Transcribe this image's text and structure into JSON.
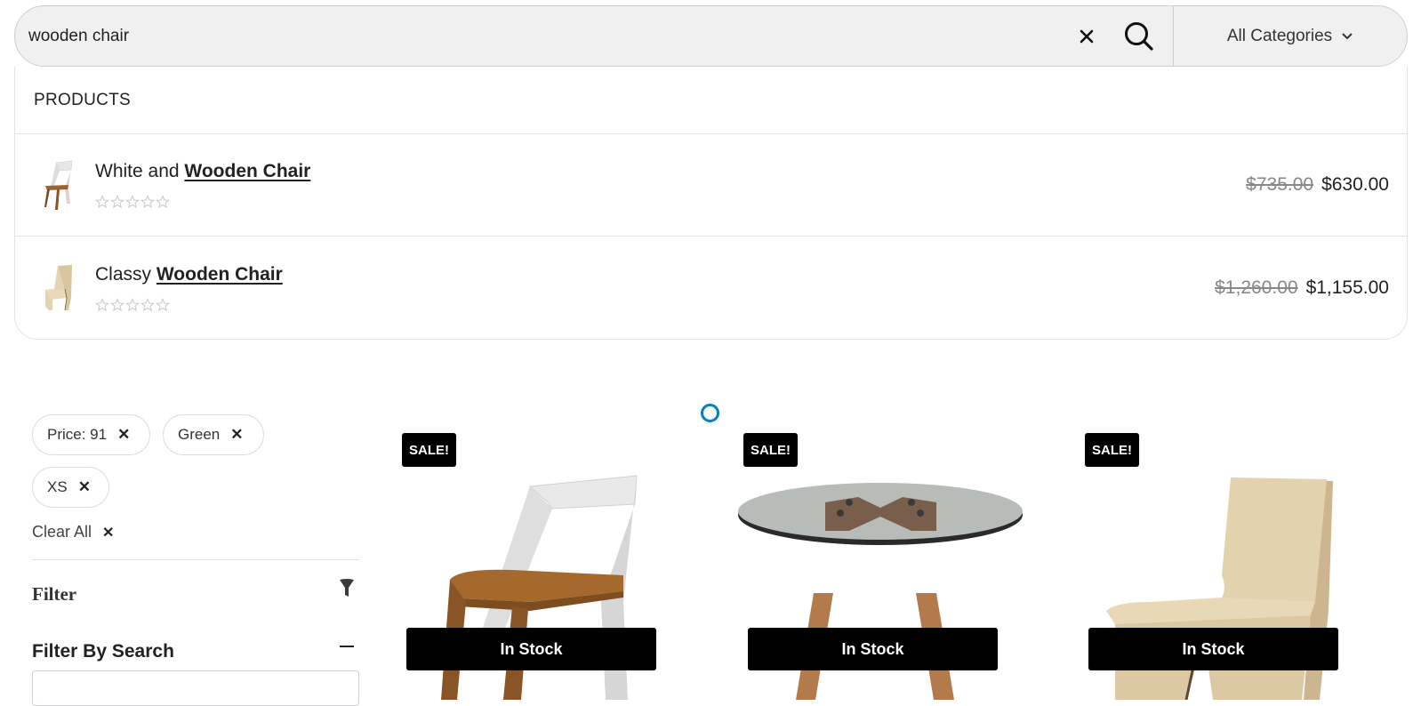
{
  "search": {
    "query": "wooden chair",
    "placeholder": "Search for products",
    "clear_icon": "close-icon",
    "search_icon": "search-icon",
    "category": "All Categories",
    "category_icon": "chevron-down-icon"
  },
  "results": {
    "section_label": "PRODUCTS",
    "items": [
      {
        "prefix": "White and ",
        "highlight": "Wooden Chair",
        "rating": 0,
        "rating_max": 5,
        "old_price": "$735.00",
        "price": "$630.00",
        "thumb": "white-wooden-chair"
      },
      {
        "prefix": "Classy ",
        "highlight": "Wooden Chair",
        "rating": 0,
        "rating_max": 5,
        "old_price": "$1,260.00",
        "price": "$1,155.00",
        "thumb": "classy-wooden-chair"
      }
    ]
  },
  "sidebar": {
    "active_filters": [
      {
        "label": "Price: 91"
      },
      {
        "label": "Green"
      },
      {
        "label": "XS"
      }
    ],
    "remove_symbol": "✕",
    "clear_all": "Clear All",
    "filter_title": "Filter",
    "filter_icon": "funnel-icon",
    "filter_by_search_title": "Filter By Search",
    "filter_by_search_value": ""
  },
  "products": [
    {
      "badge": "SALE!",
      "stock": "In Stock",
      "image": "white-wooden-chair"
    },
    {
      "badge": "SALE!",
      "stock": "In Stock",
      "image": "glass-round-table"
    },
    {
      "badge": "SALE!",
      "stock": "In Stock",
      "image": "classy-wooden-chair"
    }
  ],
  "colors": {
    "accent_loader": "#0a7cc1",
    "badge_bg": "#000000",
    "search_bg": "#f0f0f0"
  }
}
